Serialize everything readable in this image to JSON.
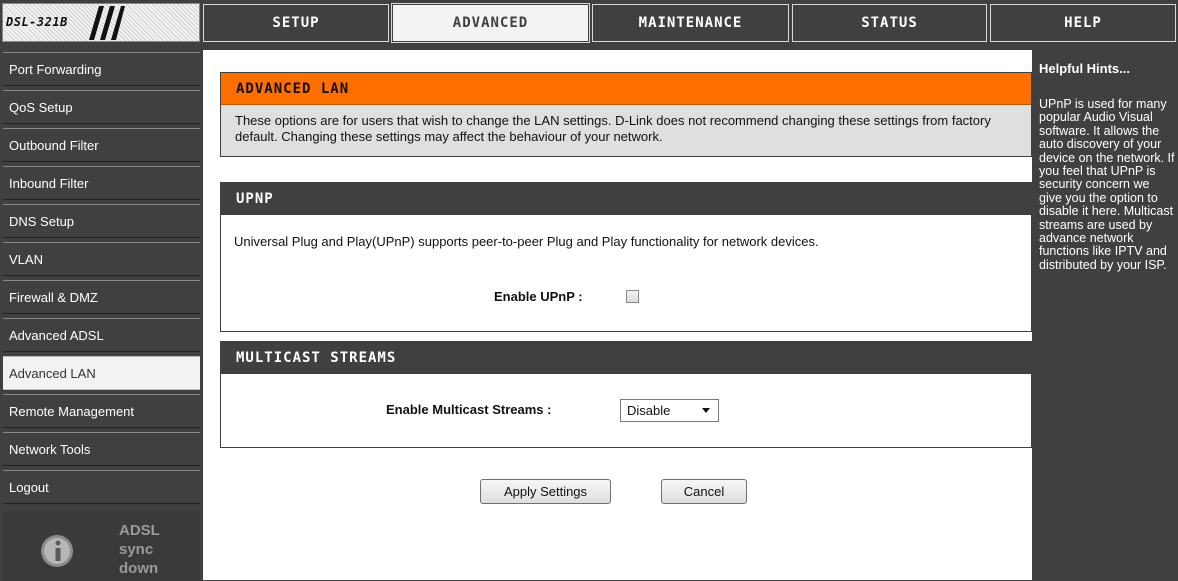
{
  "logo": {
    "model": "DSL-321B"
  },
  "tabs": [
    {
      "label": "SETUP",
      "active": false
    },
    {
      "label": "ADVANCED",
      "active": true
    },
    {
      "label": "MAINTENANCE",
      "active": false
    },
    {
      "label": "STATUS",
      "active": false
    },
    {
      "label": "HELP",
      "active": false
    }
  ],
  "sidebar": {
    "items": [
      {
        "label": "Port Forwarding"
      },
      {
        "label": "QoS Setup"
      },
      {
        "label": "Outbound Filter"
      },
      {
        "label": "Inbound Filter"
      },
      {
        "label": "DNS Setup"
      },
      {
        "label": "VLAN"
      },
      {
        "label": "Firewall & DMZ"
      },
      {
        "label": "Advanced ADSL"
      },
      {
        "label": "Advanced LAN",
        "active": true
      },
      {
        "label": "Remote Management"
      },
      {
        "label": "Network Tools"
      },
      {
        "label": "Logout"
      }
    ],
    "adsl_status": {
      "line1": "ADSL",
      "line2": "sync",
      "line3": "down"
    }
  },
  "intro": {
    "title": "ADVANCED LAN",
    "text": "These options are for users that wish to change the LAN settings. D-Link does not recommend changing these settings from factory default. Changing these settings may affect the behaviour of your network."
  },
  "upnp": {
    "title": "UPNP",
    "description": "Universal Plug and Play(UPnP) supports peer-to-peer Plug and Play functionality for network devices.",
    "enable_label": "Enable UPnP :",
    "enabled": false
  },
  "multicast": {
    "title": "MULTICAST STREAMS",
    "enable_label": "Enable Multicast Streams :",
    "selected": "Disable"
  },
  "actions": {
    "apply": "Apply Settings",
    "cancel": "Cancel"
  },
  "hints": {
    "title": "Helpful Hints...",
    "text": "UPnP is used for many popular Audio Visual software. It allows the auto discovery of your device on the network. If you feel that UPnP is security concern we give you the option to disable it here. Multicast streams are used by advance network functions like IPTV and distributed by your ISP."
  },
  "colors": {
    "accent": "#ff6f00",
    "chrome": "#404040",
    "intro_bg": "#dfdfdf"
  }
}
